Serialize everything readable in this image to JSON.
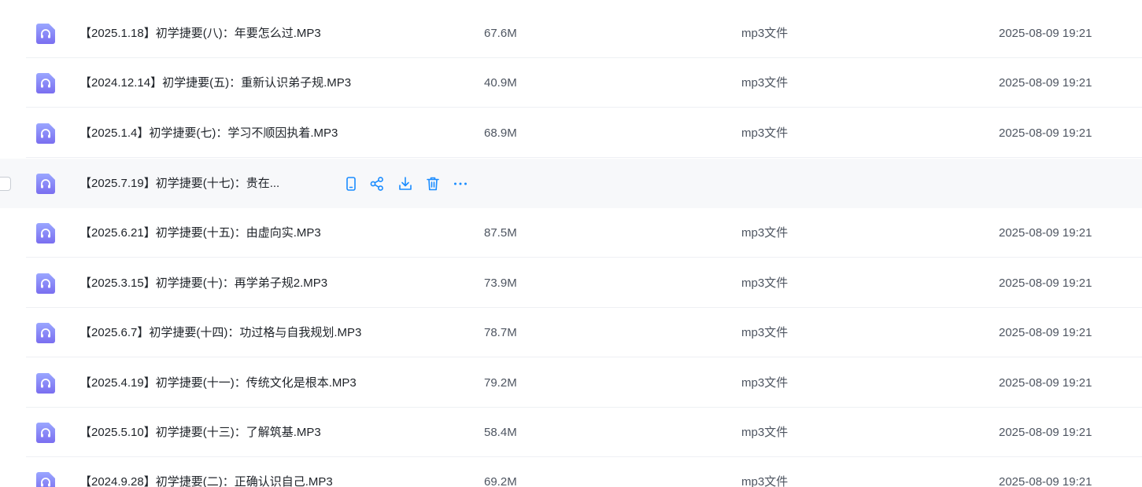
{
  "files": [
    {
      "name": "【2025.1.18】初学捷要(八)：年要怎么过.MP3",
      "size": "67.6M",
      "type": "mp3文件",
      "date": "2025-08-09 19:21"
    },
    {
      "name": "【2024.12.14】初学捷要(五)：重新认识弟子规.MP3",
      "size": "40.9M",
      "type": "mp3文件",
      "date": "2025-08-09 19:21"
    },
    {
      "name": "【2025.1.4】初学捷要(七)：学习不顺因执着.MP3",
      "size": "68.9M",
      "type": "mp3文件",
      "date": "2025-08-09 19:21"
    },
    {
      "name": "【2025.7.19】初学捷要(十七)：贵在...",
      "size": "",
      "type": "",
      "date": ""
    },
    {
      "name": "【2025.6.21】初学捷要(十五)：由虚向实.MP3",
      "size": "87.5M",
      "type": "mp3文件",
      "date": "2025-08-09 19:21"
    },
    {
      "name": "【2025.3.15】初学捷要(十)：再学弟子规2.MP3",
      "size": "73.9M",
      "type": "mp3文件",
      "date": "2025-08-09 19:21"
    },
    {
      "name": "【2025.6.7】初学捷要(十四)：功过格与自我规划.MP3",
      "size": "78.7M",
      "type": "mp3文件",
      "date": "2025-08-09 19:21"
    },
    {
      "name": "【2025.4.19】初学捷要(十一)：传统文化是根本.MP3",
      "size": "79.2M",
      "type": "mp3文件",
      "date": "2025-08-09 19:21"
    },
    {
      "name": "【2025.5.10】初学捷要(十三)：了解筑基.MP3",
      "size": "58.4M",
      "type": "mp3文件",
      "date": "2025-08-09 19:21"
    },
    {
      "name": "【2024.9.28】初学捷要(二)：正确认识自己.MP3",
      "size": "69.2M",
      "type": "mp3文件",
      "date": "2025-08-09 19:21"
    }
  ],
  "hover_row_index": 3,
  "hover_actions": [
    {
      "icon": "phone-icon",
      "action": "send-to-phone"
    },
    {
      "icon": "share-icon",
      "action": "share"
    },
    {
      "icon": "download-icon",
      "action": "download"
    },
    {
      "icon": "trash-icon",
      "action": "delete"
    },
    {
      "icon": "more-icon",
      "action": "more"
    }
  ],
  "colors": {
    "icon_gradient_top": "#9aa6ff",
    "icon_gradient_bottom": "#7a6ef0",
    "action_blue": "#1a8cff",
    "hover_bg": "#f7f8fa"
  }
}
